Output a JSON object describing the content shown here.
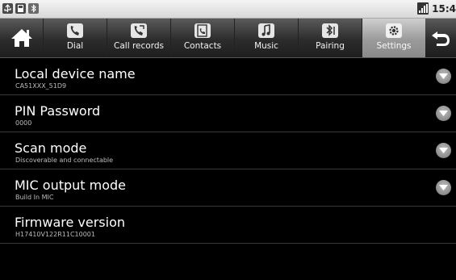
{
  "status_bar": {
    "left_icons": [
      "usb-icon",
      "sd-card-icon",
      "bluetooth-icon"
    ],
    "time": "15:4"
  },
  "tabs": {
    "home_icon": "home-icon",
    "items": [
      {
        "label": "Dial",
        "icon": "phone-icon",
        "active": false
      },
      {
        "label": "Call records",
        "icon": "call-log-icon",
        "active": false
      },
      {
        "label": "Contacts",
        "icon": "contacts-icon",
        "active": false
      },
      {
        "label": "Music",
        "icon": "music-icon",
        "active": false
      },
      {
        "label": "Pairing",
        "icon": "bluetooth-pairing-icon",
        "active": false
      },
      {
        "label": "Settings",
        "icon": "gear-icon",
        "active": true
      }
    ],
    "back_icon": "back-arrow-icon"
  },
  "settings": {
    "rows": [
      {
        "title": "Local device name",
        "value": "CA51XXX_51D9",
        "has_chevron": true
      },
      {
        "title": "PIN Password",
        "value": "0000",
        "has_chevron": true
      },
      {
        "title": "Scan mode",
        "value": "Discoverable and connectable",
        "has_chevron": true
      },
      {
        "title": "MIC output mode",
        "value": "Build In MIC",
        "has_chevron": true
      },
      {
        "title": "Firmware version",
        "value": "H17410V122R11C10001",
        "has_chevron": false
      }
    ]
  },
  "colors": {
    "background": "#000000",
    "active_tab": "#a8a8a8",
    "text_primary": "#ffffff",
    "text_secondary": "#bcbcbc"
  }
}
